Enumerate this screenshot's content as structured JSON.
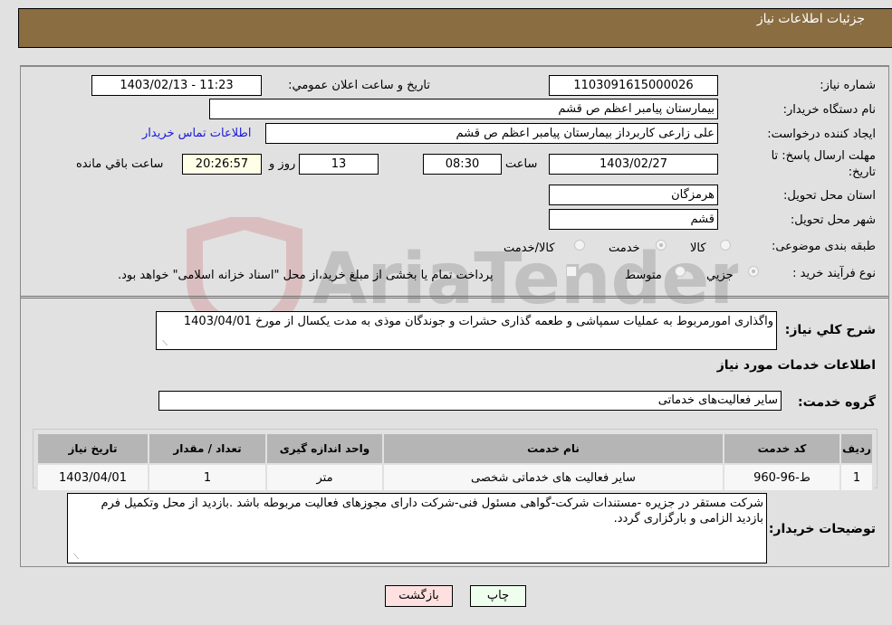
{
  "header": {
    "title": "جزئیات اطلاعات نیاز"
  },
  "form": {
    "need_number": {
      "label": "شماره نیاز:",
      "value": "1103091615000026"
    },
    "announce_datetime": {
      "label": "تاریخ و ساعت اعلان عمومي:",
      "value": "1403/02/13 - 11:23"
    },
    "buyer_org": {
      "label": "نام دستگاه خریدار:",
      "value": "بیمارستان پیامبر اعظم  ص  قشم"
    },
    "requester": {
      "label": "ایجاد کننده درخواست:",
      "value": "علی زارعی کاربرداز بیمارستان پیامبر اعظم  ص  قشم"
    },
    "buyer_contact_link": "اطلاعات تماس خریدار",
    "deadline": {
      "label_line1": "مهلت ارسال پاسخ: تا",
      "label_line2": "تاریخ:",
      "date": "1403/02/27",
      "time_label": "ساعت",
      "time": "08:30",
      "days": "13",
      "days_label": "روز و",
      "remaining": "20:26:57",
      "remaining_label": "ساعت باقي مانده"
    },
    "province": {
      "label": "استان محل تحویل:",
      "value": "هرمزگان"
    },
    "city": {
      "label": "شهر محل تحویل:",
      "value": "قشم"
    },
    "category": {
      "label": "طبقه بندی موضوعی:",
      "options": [
        "کالا",
        "خدمت",
        "کالا/خدمت"
      ],
      "selected": "خدمت"
    },
    "purchase_type": {
      "label": "نوع فرآیند خرید :",
      "options": [
        "جزیي",
        "متوسط"
      ],
      "selected": "جزیي",
      "treasury_note": "پرداخت تمام یا بخشی از مبلغ خرید،از محل \"اسناد خزانه اسلامی\" خواهد بود."
    },
    "description": {
      "label": "شرح کلي نیاز:",
      "value": "واگذاری امورمربوط به عملیات سمپاشی و طعمه گذاری حشرات و جوندگان موذی به مدت یکسال از مورخ 1403/04/01"
    },
    "services_section_title": "اطلاعات خدمات مورد نیاز",
    "service_group": {
      "label": "گروه خدمت:",
      "value": "سایر فعالیت‌های خدماتی"
    }
  },
  "table": {
    "headers": [
      "ردیف",
      "کد خدمت",
      "نام خدمت",
      "واحد اندازه گیری",
      "تعداد / مقدار",
      "تاریخ نیاز"
    ],
    "rows": [
      {
        "row": "1",
        "code": "ط-96-960",
        "name": "سایر فعالیت های خدماتی شخصی",
        "unit": "متر",
        "qty": "1",
        "date": "1403/04/01"
      }
    ]
  },
  "buyer_notes": {
    "label": "توضیحات خریدار:",
    "value": "شرکت مستقر در جزیره -مستندات شرکت-گواهی مسئول فنی-شرکت دارای مجوزهای فعالیت مربوطه باشد .بازدید از محل وتکمیل فرم بازدید الزامی  و بارگزاری گردد."
  },
  "buttons": {
    "print": "چاپ",
    "back": "بازگشت"
  },
  "colors": {
    "header_bg": "#8b6d42",
    "print_bg": "#eeffee",
    "back_bg": "#ffe0e0",
    "remaining_bg": "#ffffe8",
    "link": "#1b1bd9"
  },
  "watermark": "AriaTender.neT"
}
